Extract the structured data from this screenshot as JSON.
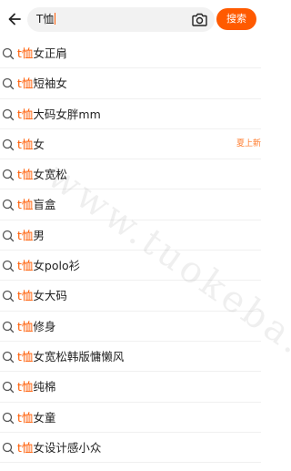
{
  "header": {
    "back_icon": "arrow-left-icon",
    "query": "T恤",
    "camera_icon": "camera-icon",
    "search_label": "搜索"
  },
  "colors": {
    "accent": "#ff5a00",
    "tag": "#ff7a2a"
  },
  "suggestions": [
    {
      "prefix": "t恤",
      "rest": "女正肩"
    },
    {
      "prefix": "t恤",
      "rest": "短袖女"
    },
    {
      "prefix": "t恤",
      "rest": "大码女胖mm"
    },
    {
      "prefix": "t恤",
      "rest": "女",
      "tag": "夏上新"
    },
    {
      "prefix": "t恤",
      "rest": "女宽松"
    },
    {
      "prefix": "t恤",
      "rest": "盲盒"
    },
    {
      "prefix": "t恤",
      "rest": "男"
    },
    {
      "prefix": "t恤",
      "rest": "女polo衫"
    },
    {
      "prefix": "t恤",
      "rest": "女大码"
    },
    {
      "prefix": "t恤",
      "rest": "修身"
    },
    {
      "prefix": "t恤",
      "rest": "女宽松韩版慵懒风"
    },
    {
      "prefix": "t恤",
      "rest": "纯棉"
    },
    {
      "prefix": "t恤",
      "rest": "女童"
    },
    {
      "prefix": "t恤",
      "rest": "女设计感小众"
    }
  ],
  "watermark": "www.tuokeba.com"
}
